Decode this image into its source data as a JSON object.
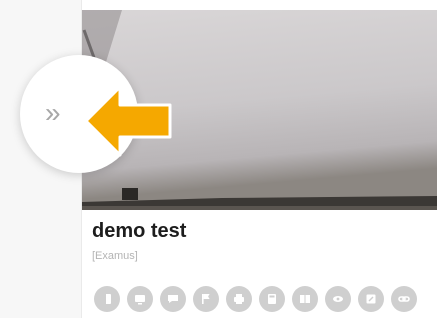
{
  "sidebar": {
    "toggle_glyph": "»",
    "toggle_icon": "double-chevron-right-icon"
  },
  "card": {
    "title": "demo test",
    "subtitle": "[Examus]",
    "actions": [
      {
        "icon": "document-icon"
      },
      {
        "icon": "screen-share-icon"
      },
      {
        "icon": "chat-icon"
      },
      {
        "icon": "flag-icon"
      },
      {
        "icon": "printer-icon"
      },
      {
        "icon": "calculator-icon"
      },
      {
        "icon": "book-icon"
      },
      {
        "icon": "eye-icon"
      },
      {
        "icon": "edit-icon"
      },
      {
        "icon": "link-icon"
      }
    ]
  },
  "annotation": {
    "arrow_color": "#f5a800",
    "arrow_icon": "arrow-left-icon"
  }
}
